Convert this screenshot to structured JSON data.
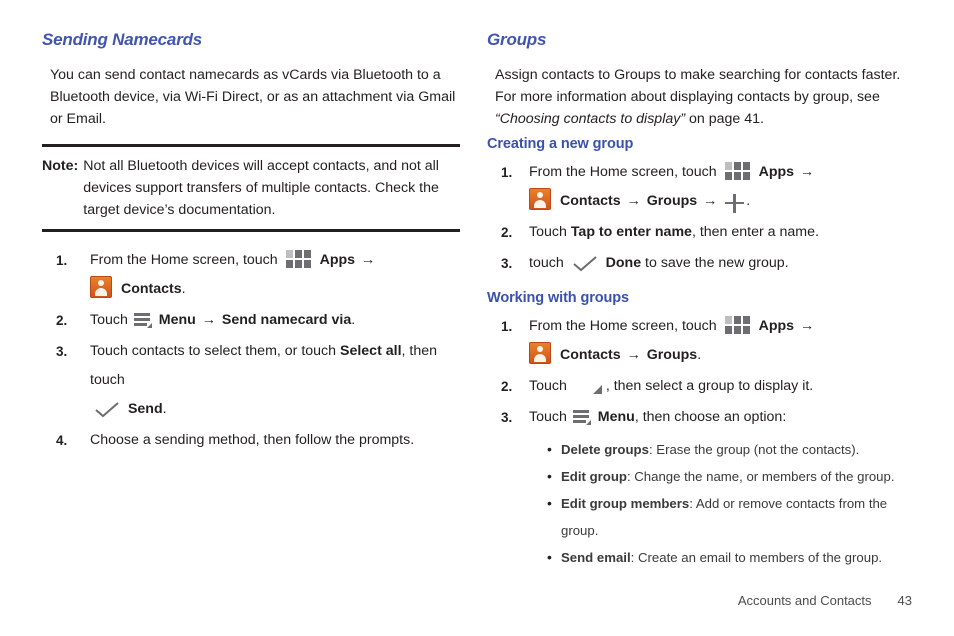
{
  "left_column": {
    "section_title": "Sending Namecards",
    "intro_paragraph": "You can send contact namecards as vCards via Bluetooth to a Bluetooth device, via Wi-Fi Direct, or as an attachment via Gmail or Email.",
    "note": {
      "label": "Note:",
      "text": "Not all Bluetooth devices will accept contacts, and not all devices support transfers of multiple contacts. Check the target device’s documentation."
    },
    "steps": [
      {
        "number": "1.",
        "text_before_apps": "From the Home screen, touch",
        "apps_label": "Apps",
        "arrow": "→",
        "contacts_label": "Contacts",
        "trailing": "."
      },
      {
        "number": "2.",
        "text_before_menu": "Touch",
        "menu_label": "Menu",
        "arrow": "→",
        "action_label": "Send namecard via",
        "trailing": "."
      },
      {
        "number": "3.",
        "text_a": "Touch contacts to select them, or touch",
        "bold_a": "Select all",
        "text_b": ", then touch",
        "bold_b": "Send",
        "trailing": "."
      },
      {
        "number": "4.",
        "text": "Choose a sending method, then follow the prompts."
      }
    ]
  },
  "right_column": {
    "section_title": "Groups",
    "intro_text_a": "Assign contacts to Groups to make searching for contacts faster. For more information about displaying contacts by group, see",
    "intro_italic": "“Choosing contacts to display”",
    "intro_text_b": "on page 41.",
    "creating_group": {
      "sub_title": "Creating a new group",
      "steps": [
        {
          "number": "1.",
          "text_before_apps": "From the Home screen, touch",
          "apps_label": "Apps",
          "arrow1": "→",
          "contacts_label": "Contacts",
          "arrow2": "→",
          "groups_label": "Groups",
          "arrow3": "→",
          "trailing": "."
        },
        {
          "number": "2.",
          "text_a": "Touch",
          "bold_a": "Tap to enter name",
          "text_b": ", then enter a name."
        },
        {
          "number": "3.",
          "text_a": "touch",
          "bold_a": "Done",
          "text_b": "to save the new group."
        }
      ]
    },
    "working_with_groups": {
      "sub_title": "Working with groups",
      "steps": [
        {
          "number": "1.",
          "text_before_apps": "From the Home screen, touch",
          "apps_label": "Apps",
          "arrow1": "→",
          "contacts_label": "Contacts",
          "arrow2": "→",
          "groups_label": "Groups",
          "trailing": "."
        },
        {
          "number": "2.",
          "text_a": "Touch",
          "text_b": ", then select a group to display it."
        },
        {
          "number": "3.",
          "text_a": "Touch",
          "bold_a": "Menu",
          "text_b": ", then choose an option:"
        }
      ],
      "options": [
        {
          "bullet": "•",
          "term": "Delete groups",
          "separator": ":",
          "description": "Erase the group (not the contacts)."
        },
        {
          "bullet": "•",
          "term": "Edit group",
          "separator": ":",
          "description": "Change the name, or members of the group."
        },
        {
          "bullet": "•",
          "term": "Edit group members",
          "separator": ":",
          "description": "Add or remove contacts from the group."
        },
        {
          "bullet": "•",
          "term": "Send email",
          "separator": ":",
          "description": "Create an email to members of the group."
        }
      ]
    }
  },
  "footer": {
    "section_name": "Accounts and Contacts",
    "page_number": "43"
  },
  "icons": {
    "apps": "apps-grid-icon",
    "contacts": "contacts-person-icon",
    "menu": "menu-hamburger-icon",
    "check": "check-icon",
    "plus": "plus-icon",
    "expand": "expand-triangle-icon"
  },
  "colors": {
    "heading_blue": "#4054b2",
    "subheading_blue": "#3a52ad",
    "body_text": "#231f20",
    "contacts_icon_orange": "#d2521b",
    "icon_gray": "#6d6e71"
  }
}
